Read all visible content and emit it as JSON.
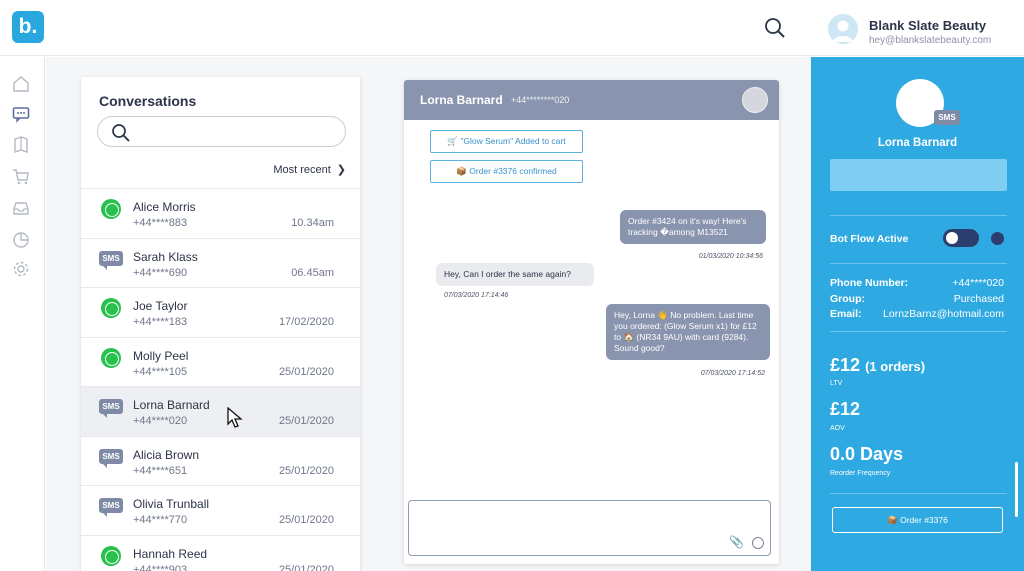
{
  "app": {
    "logo": "b."
  },
  "header": {
    "brand_name": "Blank Slate Beauty",
    "brand_email": "hey@blankslatebeauty.com",
    "icons": [
      "search-icon",
      "avatar"
    ]
  },
  "rail": {
    "icons": [
      "home-icon",
      "chat-icon",
      "book-icon",
      "cart-icon",
      "inbox-icon",
      "chart-icon",
      "settings-icon"
    ]
  },
  "conversations": {
    "title": "Conversations",
    "search_placeholder": "",
    "sort_label": "Most recent",
    "items": [
      {
        "channel": "whatsapp",
        "name": "Alice Morris",
        "phone": "+44****883",
        "time": "10.34am"
      },
      {
        "channel": "sms",
        "name": "Sarah Klass",
        "phone": "+44****690",
        "time": "06.45am"
      },
      {
        "channel": "whatsapp",
        "name": "Joe Taylor",
        "phone": "+44****183",
        "time": "17/02/2020"
      },
      {
        "channel": "whatsapp",
        "name": "Molly Peel",
        "phone": "+44****105",
        "time": "25/01/2020"
      },
      {
        "channel": "sms",
        "name": "Lorna Barnard",
        "phone": "+44****020",
        "time": "25/01/2020"
      },
      {
        "channel": "sms",
        "name": "Alicia Brown",
        "phone": "+44****651",
        "time": "25/01/2020"
      },
      {
        "channel": "sms",
        "name": "Olivia Trunball",
        "phone": "+44****770",
        "time": "25/01/2020"
      },
      {
        "channel": "whatsapp",
        "name": "Hannah Reed",
        "phone": "+44****903",
        "time": "25/01/2020"
      }
    ],
    "sms_badge": "SMS"
  },
  "chat": {
    "name": "Lorna Barnard",
    "phone": "+44********020",
    "events": [
      "🛒 \"Glow Serum\" Added to cart",
      "📦 Order #3376 confirmed"
    ],
    "messages": [
      {
        "dir": "out",
        "text": "Order #3424 on it's way! Here's tracking �among M13521",
        "time": "01/03/2020 10:34:56"
      },
      {
        "dir": "in",
        "text": "Hey, Can I order the same again?",
        "time": "07/03/2020 17:14:46"
      },
      {
        "dir": "out",
        "text": "Hey, Lorna 👋 No problem. Last time you ordered: (Glow Serum x1) for £12 to 🏠 (NR34 9AU) with card (9284). Sound good?",
        "time": "07/03/2020 17:14:52"
      }
    ],
    "composer_placeholder": ""
  },
  "customer": {
    "name": "Lorna Barnard",
    "badge": "SMS",
    "bot_flow_label": "Bot Flow Active",
    "bot_flow_on": false,
    "details": [
      {
        "label": "Phone Number:",
        "value": "+44****020"
      },
      {
        "label": "Group:",
        "value": "Purchased"
      },
      {
        "label": "Email:",
        "value": "LornzBarnz@hotmail.com"
      }
    ],
    "ltv_value": "£12",
    "ltv_orders": "(1 orders)",
    "ltv_label": "LTV",
    "aov_value": "£12",
    "aov_label": "AOV",
    "reorder_value": "0.0 Days",
    "reorder_label": "Reorder Frequency",
    "order_button": "📦 Order #3376"
  },
  "colors": {
    "brand": "#29a8e0",
    "panel": "#2fa9e1",
    "chat_header": "#8994ae",
    "whatsapp": "#27c24c",
    "sms": "#7f8aa6"
  }
}
